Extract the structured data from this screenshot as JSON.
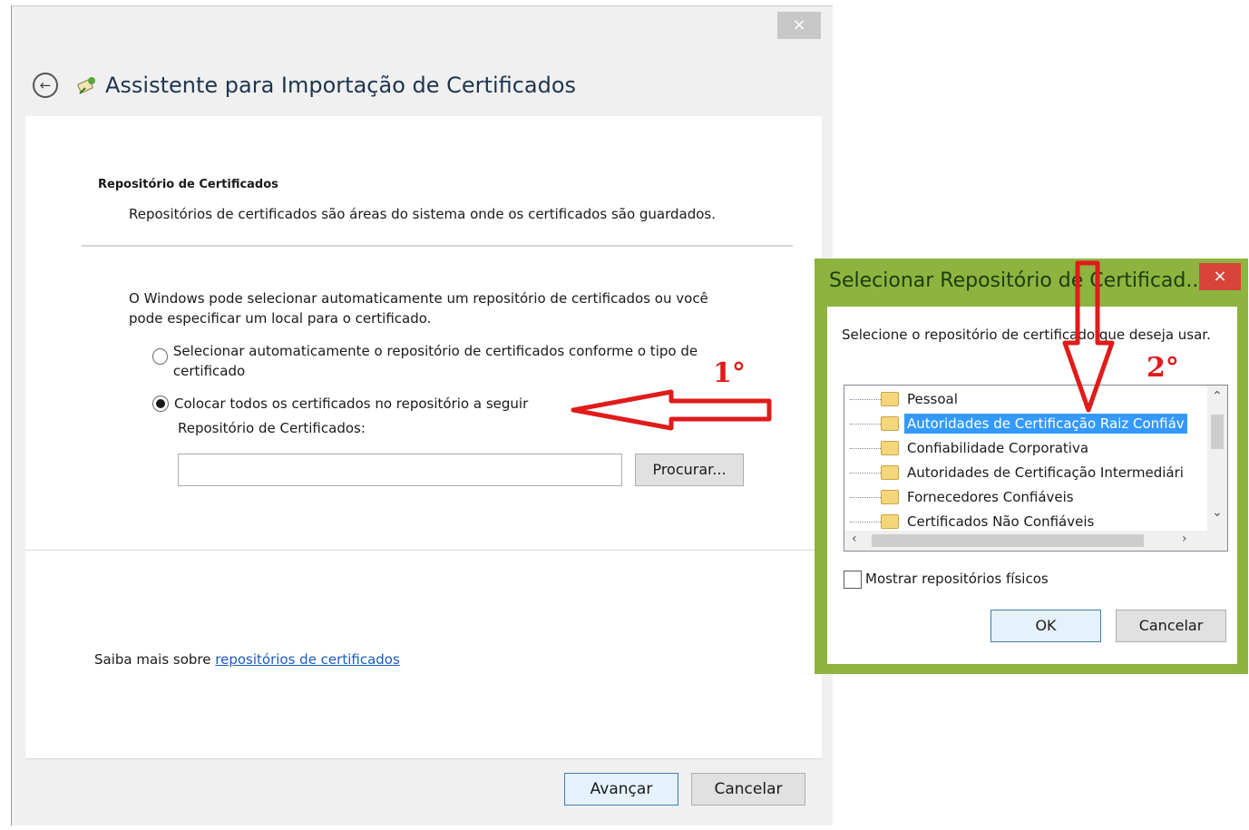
{
  "main_window": {
    "title": "Assistente para Importação de Certificados",
    "close_glyph": "×",
    "section_title": "Repositório de Certificados",
    "section_desc": "Repositórios de certificados são áreas do sistema onde os certificados são guardados.",
    "intro": "O Windows pode selecionar automaticamente um repositório de certificados ou você pode especificar um local para o certificado.",
    "option_auto": "Selecionar automaticamente o repositório de certificados conforme o tipo de certificado",
    "option_manual": "Colocar todos os certificados no repositório a seguir",
    "selected_option": "manual",
    "store_label": "Repositório de Certificados:",
    "store_value": "",
    "browse_button": "Procurar...",
    "learn_more_prefix": "Saiba mais sobre ",
    "learn_more_link": "repositórios de certificados",
    "next_button": "Avançar",
    "cancel_button": "Cancelar"
  },
  "annotations": {
    "step1": "1°",
    "step2": "2°",
    "arrow_color": "#e01b1b"
  },
  "dialog": {
    "title": "Selecionar Repositório de Certificad...",
    "close_glyph": "×",
    "description": "Selecione o repositório de certificado que deseja usar.",
    "stores": [
      {
        "label": "Pessoal",
        "selected": false
      },
      {
        "label": "Autoridades de Certificação Raiz Confiáv",
        "selected": true
      },
      {
        "label": "Confiabilidade Corporativa",
        "selected": false
      },
      {
        "label": "Autoridades de Certificação Intermediári",
        "selected": false
      },
      {
        "label": "Fornecedores Confiáveis",
        "selected": false
      },
      {
        "label": "Certificados Não Confiáveis",
        "selected": false
      }
    ],
    "show_physical_label": "Mostrar repositórios físicos",
    "show_physical_checked": false,
    "ok_button": "OK",
    "cancel_button": "Cancelar",
    "frame_color": "#8cb43f"
  }
}
